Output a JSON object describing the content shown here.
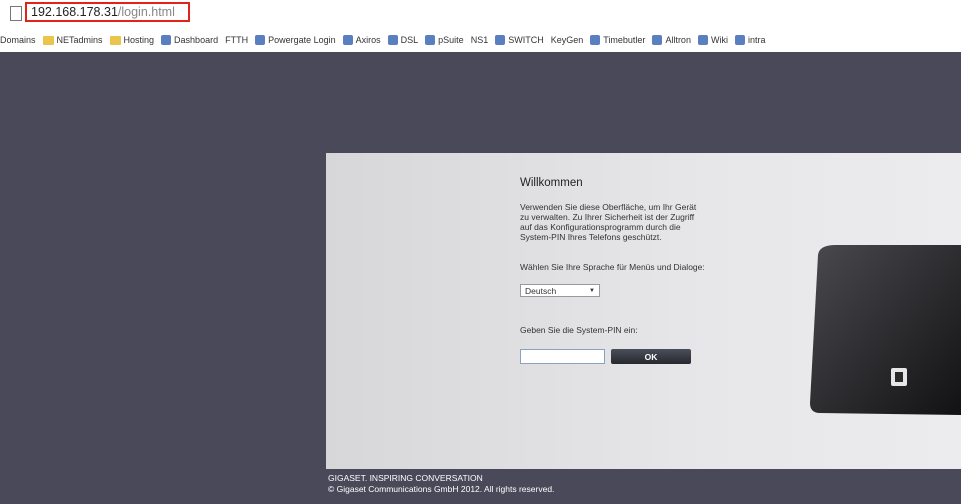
{
  "browser": {
    "url_host": "192.168.178.31",
    "url_path": "/login.html",
    "bookmarks": [
      {
        "label": "Domains",
        "icon": "folder-icon"
      },
      {
        "label": "NETadmins",
        "icon": "folder-icon"
      },
      {
        "label": "Hosting",
        "icon": "folder-icon"
      },
      {
        "label": "Dashboard",
        "icon": "app-icon"
      },
      {
        "label": "FTTH",
        "icon": "page-icon"
      },
      {
        "label": "Powergate Login",
        "icon": "app-icon"
      },
      {
        "label": "Axiros",
        "icon": "app-icon"
      },
      {
        "label": "DSL",
        "icon": "app-icon"
      },
      {
        "label": "pSuite",
        "icon": "app-icon"
      },
      {
        "label": "NS1",
        "icon": "page-icon"
      },
      {
        "label": "SWITCH",
        "icon": "app-icon"
      },
      {
        "label": "KeyGen",
        "icon": "page-icon"
      },
      {
        "label": "Timebutler",
        "icon": "app-icon"
      },
      {
        "label": "Alltron",
        "icon": "app-icon"
      },
      {
        "label": "Wiki",
        "icon": "app-icon"
      },
      {
        "label": "intra",
        "icon": "app-icon"
      }
    ]
  },
  "login": {
    "welcome": "Willkommen",
    "intro": "Verwenden Sie diese Oberfläche, um Ihr Gerät zu verwalten. Zu Ihrer Sicherheit ist der Zugriff auf das Konfigurationsprogramm durch die System-PIN Ihres Telefons geschützt.",
    "language_label": "Wählen Sie Ihre Sprache für Menüs und Dialoge:",
    "language_selected": "Deutsch",
    "pin_label": "Geben Sie die System-PIN ein:",
    "pin_value": "",
    "ok_button": "OK"
  },
  "footer": {
    "line1": "GIGASET. INSPIRING CONVERSATION",
    "line2": "© Gigaset Communications GmbH 2012. All rights reserved."
  }
}
